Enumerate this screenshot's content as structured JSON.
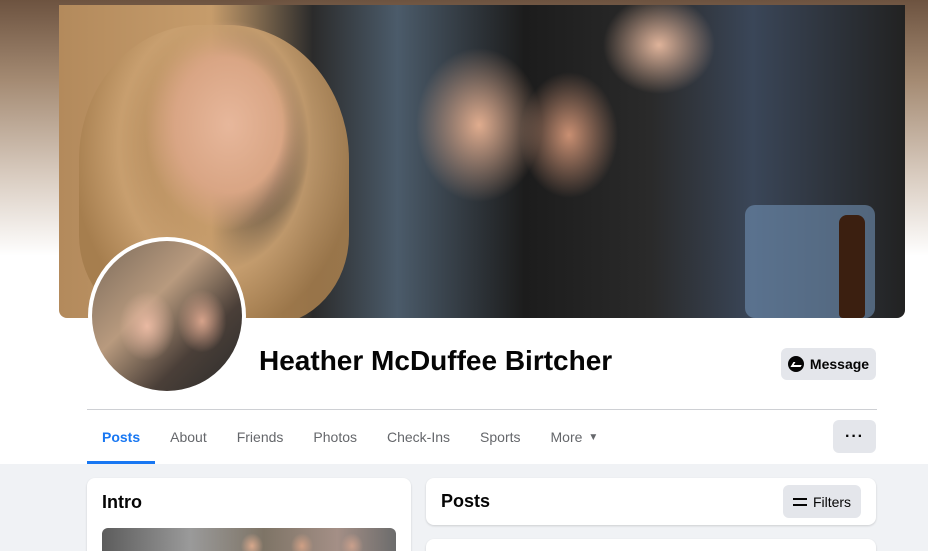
{
  "profile": {
    "name": "Heather McDuffee Birtcher"
  },
  "actions": {
    "message_label": "Message",
    "more_options_label": "···"
  },
  "tabs": [
    {
      "label": "Posts",
      "active": true
    },
    {
      "label": "About",
      "active": false
    },
    {
      "label": "Friends",
      "active": false
    },
    {
      "label": "Photos",
      "active": false
    },
    {
      "label": "Check-Ins",
      "active": false
    },
    {
      "label": "Sports",
      "active": false
    },
    {
      "label": "More",
      "active": false
    }
  ],
  "intro": {
    "title": "Intro"
  },
  "posts": {
    "title": "Posts",
    "filters_label": "Filters"
  },
  "icons": {
    "message": "messenger-icon",
    "more_caret": "caret-down-icon",
    "filters": "filters-sliders-icon"
  },
  "colors": {
    "accent": "#1877f2",
    "button_bg": "#e4e6eb",
    "page_bg": "#f0f2f5",
    "text_primary": "#050505",
    "text_secondary": "#65676b"
  }
}
